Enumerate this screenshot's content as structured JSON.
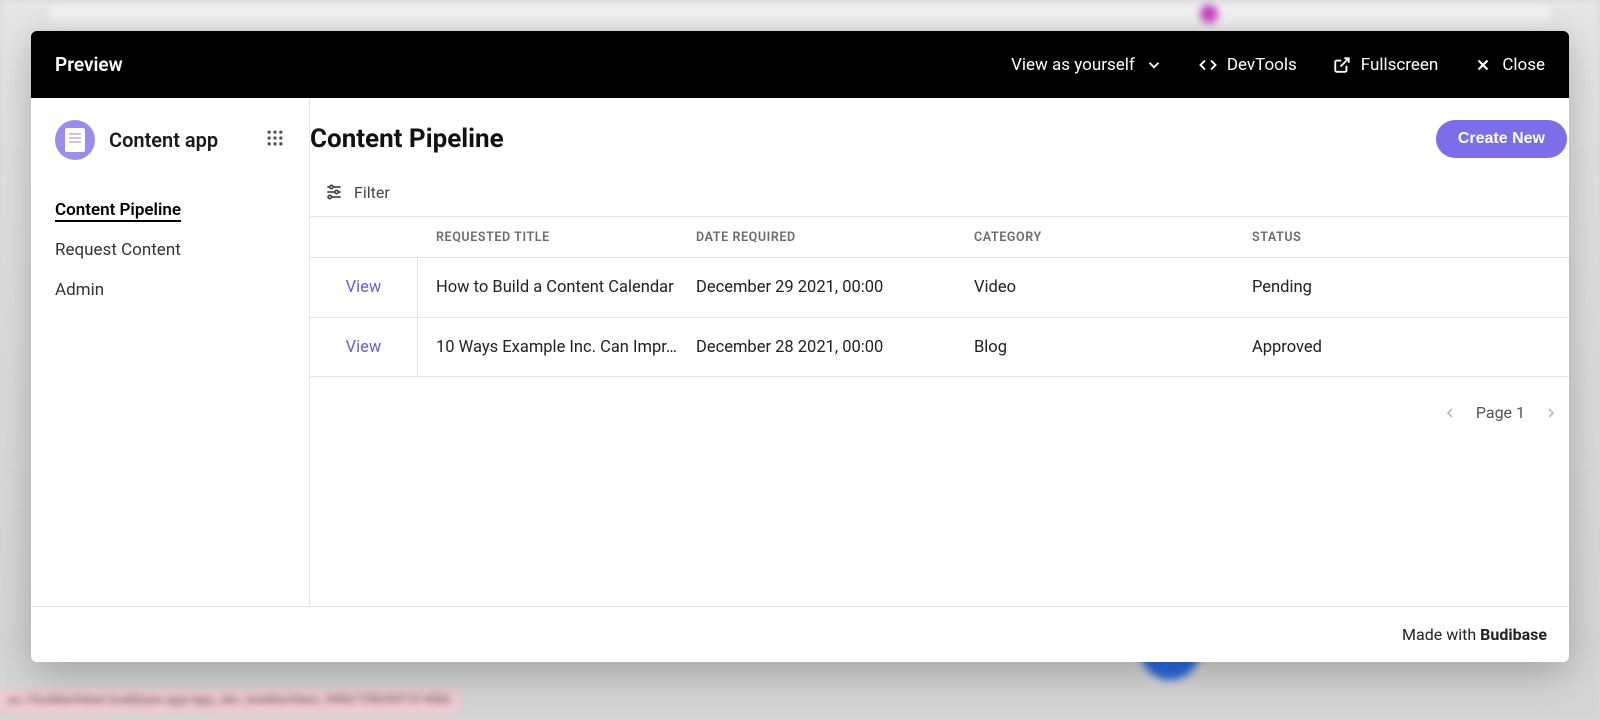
{
  "preview": {
    "title": "Preview",
    "view_as": "View as yourself",
    "devtools": "DevTools",
    "fullscreen": "Fullscreen",
    "close": "Close"
  },
  "app": {
    "name": "Content app"
  },
  "sidebar": {
    "items": [
      {
        "label": "Content Pipeline",
        "active": true
      },
      {
        "label": "Request Content",
        "active": false
      },
      {
        "label": "Admin",
        "active": false
      }
    ]
  },
  "page": {
    "title": "Content Pipeline",
    "create_label": "Create New",
    "filter_label": "Filter"
  },
  "table": {
    "columns": {
      "view": "",
      "title": "REQUESTED TITLE",
      "date": "DATE REQUIRED",
      "category": "CATEGORY",
      "status": "STATUS"
    },
    "view_link_label": "View",
    "rows": [
      {
        "title": "How to Build a Content Calendar",
        "date": "December 29 2021, 00:00",
        "category": "Video",
        "status": "Pending"
      },
      {
        "title": "10 Ways Example Inc. Can Impr…",
        "date": "December 28 2021, 00:00",
        "category": "Blog",
        "status": "Approved"
      }
    ]
  },
  "pagination": {
    "label": "Page 1"
  },
  "footer": {
    "prefix": "Made with",
    "brand": "Budibase"
  },
  "backdrop": {
    "url_hint": "ps://boldtechtest.budibase.app/app_dev_boldtechtest_949b72f8359741458c"
  }
}
